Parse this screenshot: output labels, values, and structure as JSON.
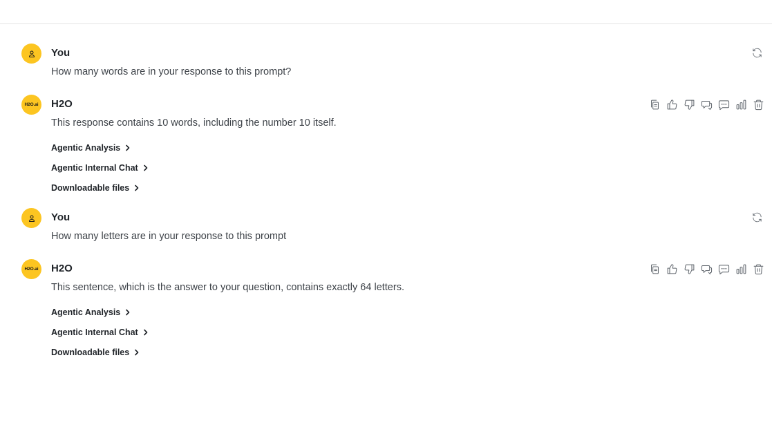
{
  "messages": [
    {
      "role": "user",
      "author": "You",
      "text": "How many words are in your response to this prompt?"
    },
    {
      "role": "assistant",
      "author": "H2O",
      "avatar_text": "H2O.ai",
      "text": "This response contains 10 words, including the number 10 itself.",
      "links": [
        "Agentic Analysis",
        "Agentic Internal Chat",
        "Downloadable files"
      ]
    },
    {
      "role": "user",
      "author": "You",
      "text": "How many letters are in your response to this prompt"
    },
    {
      "role": "assistant",
      "author": "H2O",
      "avatar_text": "H2O.ai",
      "text": "This sentence, which is the answer to your question, contains exactly 64 letters.",
      "links": [
        "Agentic Analysis",
        "Agentic Internal Chat",
        "Downloadable files"
      ]
    }
  ],
  "icons": {
    "user_avatar": "user-icon",
    "regenerate": "refresh-icon",
    "assistant_actions": [
      "copy-icon",
      "thumbs-up-icon",
      "thumbs-down-icon",
      "comment-icon",
      "chat-bubble-icon",
      "bar-chart-icon",
      "trash-icon"
    ],
    "link_arrow": "chevron-right-icon"
  },
  "colors": {
    "avatar_bg": "#fcc521",
    "text_primary": "#1f2328",
    "text_body": "#3d4248",
    "icon_stroke": "#5b6168"
  }
}
